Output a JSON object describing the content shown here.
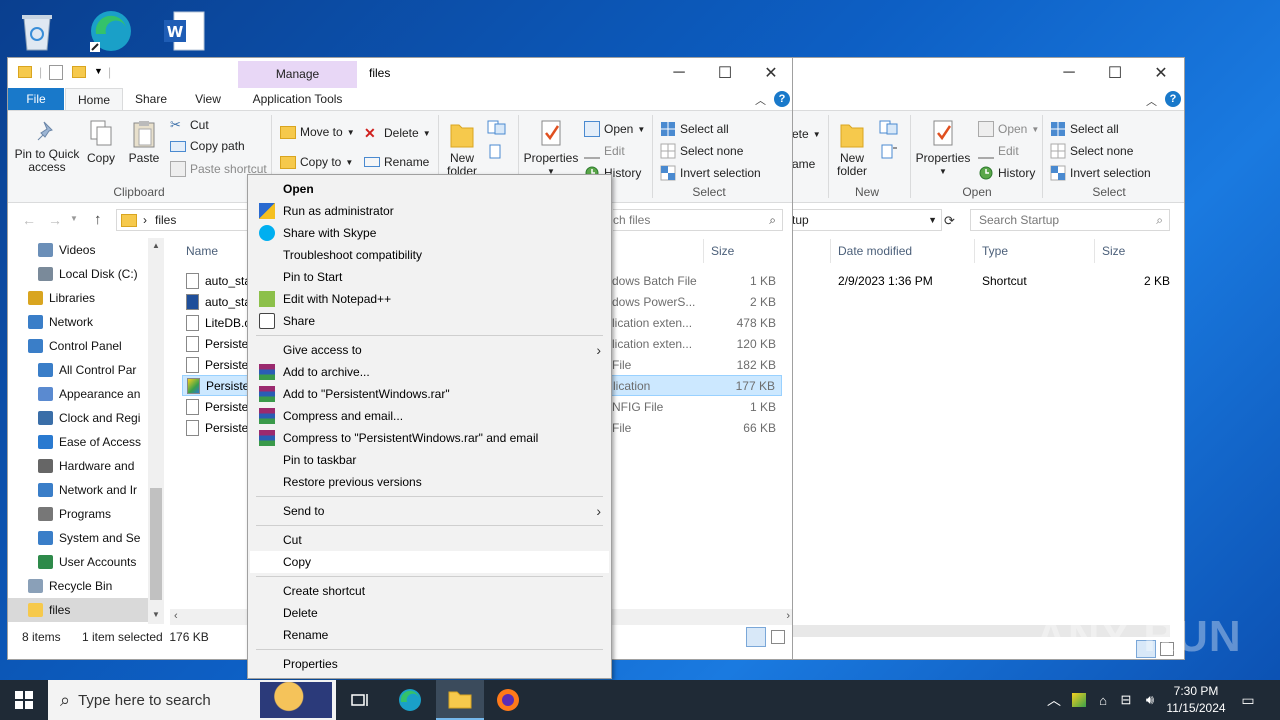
{
  "desktop": {
    "icons": [
      "recycle-bin-icon",
      "edge-icon",
      "word-icon"
    ]
  },
  "colors": {
    "manage_tab": "#e8d7f6",
    "file_tab": "#1979ca",
    "selection": "#cce8ff",
    "taskbar": "#1f2a36"
  },
  "back_window": {
    "ribbon": {
      "delete_partial": "ete",
      "rename_partial": "ame",
      "new_folder": "New\nfolder",
      "new_group": "New",
      "properties": "Properties",
      "open": "Open",
      "edit": "Edit",
      "history": "History",
      "open_group": "Open",
      "select_all": "Select all",
      "select_none": "Select none",
      "invert_selection": "Invert selection",
      "select_group": "Select"
    },
    "address_partial": "tup",
    "search_placeholder": "Search Startup",
    "columns": {
      "date": "Date modified",
      "type": "Type",
      "size": "Size"
    },
    "row": {
      "date": "2/9/2023 1:36 PM",
      "type": "Shortcut",
      "size": "2 KB"
    }
  },
  "window": {
    "title": "files",
    "tabs": {
      "manage": "Manage",
      "file": "File",
      "home": "Home",
      "share": "Share",
      "view": "View",
      "app_tools": "Application Tools"
    },
    "ribbon": {
      "pin_quick_access": "Pin to Quick access",
      "copy": "Copy",
      "paste": "Paste",
      "cut": "Cut",
      "copy_path": "Copy path",
      "paste_shortcut": "Paste shortcut",
      "clipboard_group": "Clipboard",
      "move_to": "Move to",
      "copy_to": "Copy to",
      "delete": "Delete",
      "rename": "Rename",
      "new_folder": "New\nfolder",
      "properties": "Properties",
      "open": "Open",
      "edit": "Edit",
      "history": "History",
      "select_all": "Select all",
      "select_none": "Select none",
      "invert_selection": "Invert selection",
      "select_group": "Select"
    },
    "address": {
      "path": "files",
      "search_placeholder_partial": "ch files"
    },
    "nav": [
      {
        "label": "Videos",
        "icon": "videos-icon"
      },
      {
        "label": "Local Disk (C:)",
        "icon": "drive-icon"
      },
      {
        "label": "Libraries",
        "icon": "libraries-icon"
      },
      {
        "label": "Network",
        "icon": "network-icon"
      },
      {
        "label": "Control Panel",
        "icon": "control-panel-icon"
      },
      {
        "label": "All Control Par",
        "icon": "control-panel-icon"
      },
      {
        "label": "Appearance an",
        "icon": "appearance-icon"
      },
      {
        "label": "Clock and Regi",
        "icon": "clock-icon"
      },
      {
        "label": "Ease of Access",
        "icon": "ease-access-icon"
      },
      {
        "label": "Hardware and",
        "icon": "hardware-icon"
      },
      {
        "label": "Network and Ir",
        "icon": "network-icon"
      },
      {
        "label": "Programs",
        "icon": "programs-icon"
      },
      {
        "label": "System and Se",
        "icon": "system-icon"
      },
      {
        "label": "User Accounts",
        "icon": "user-accounts-icon"
      },
      {
        "label": "Recycle Bin",
        "icon": "recycle-bin-icon"
      },
      {
        "label": "files",
        "icon": "folder-icon"
      }
    ],
    "columns": {
      "name": "Name",
      "size": "Size"
    },
    "files": [
      {
        "name": "auto_sta",
        "type": "dows Batch File",
        "size": "1 KB"
      },
      {
        "name": "auto_sta",
        "type": "dows PowerS...",
        "size": "2 KB"
      },
      {
        "name": "LiteDB.c",
        "type": "lication exten...",
        "size": "478 KB"
      },
      {
        "name": "Persiste",
        "type": "lication exten...",
        "size": "120 KB"
      },
      {
        "name": "Persiste",
        "type": "File",
        "size": "182 KB"
      },
      {
        "name": "Persiste",
        "type": "lication",
        "size": "177 KB"
      },
      {
        "name": "Persiste",
        "type": "NFIG File",
        "size": "1 KB"
      },
      {
        "name": "Persiste",
        "type": "File",
        "size": "66 KB"
      }
    ],
    "status": {
      "items": "8 items",
      "selected": "1 item selected  176 KB"
    }
  },
  "context_menu": [
    {
      "label": "Open",
      "bold": true
    },
    {
      "label": "Run as administrator",
      "icon": "shield-icon"
    },
    {
      "label": "Share with Skype",
      "icon": "skype-icon"
    },
    {
      "label": "Troubleshoot compatibility"
    },
    {
      "label": "Pin to Start"
    },
    {
      "label": "Edit with Notepad++",
      "icon": "notepadpp-icon"
    },
    {
      "label": "Share",
      "icon": "share-icon"
    },
    {
      "sep": true
    },
    {
      "label": "Give access to",
      "submenu": true
    },
    {
      "label": "Add to archive...",
      "icon": "winrar-icon"
    },
    {
      "label": "Add to \"PersistentWindows.rar\"",
      "icon": "winrar-icon"
    },
    {
      "label": "Compress and email...",
      "icon": "winrar-icon"
    },
    {
      "label": "Compress to \"PersistentWindows.rar\" and email",
      "icon": "winrar-icon"
    },
    {
      "label": "Pin to taskbar"
    },
    {
      "label": "Restore previous versions"
    },
    {
      "sep": true
    },
    {
      "label": "Send to",
      "submenu": true
    },
    {
      "sep": true
    },
    {
      "label": "Cut"
    },
    {
      "label": "Copy",
      "hover": true
    },
    {
      "sep": true
    },
    {
      "label": "Create shortcut"
    },
    {
      "label": "Delete"
    },
    {
      "label": "Rename"
    },
    {
      "sep": true
    },
    {
      "label": "Properties"
    }
  ],
  "taskbar": {
    "search_placeholder": "Type here to search",
    "time": "7:30 PM",
    "date": "11/15/2024"
  },
  "watermark": "ANY RUN"
}
